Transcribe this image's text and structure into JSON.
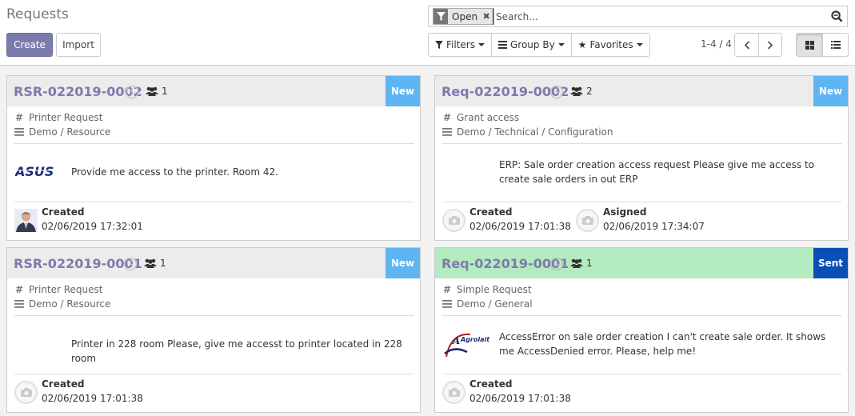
{
  "header": {
    "title": "Requests",
    "create_label": "Create",
    "import_label": "Import"
  },
  "search": {
    "facet_label": "Open",
    "placeholder": "Search..."
  },
  "filters": {
    "filters_label": "Filters",
    "groupby_label": "Group By",
    "favorites_label": "Favorites"
  },
  "pager": {
    "value": "1-4 / 4"
  },
  "colors": {
    "accent": "#7c7bad",
    "stage_new": "#5db5f1",
    "stage_sent": "#0a4fb5",
    "sent_header": "#b5ebc0"
  },
  "cards": [
    {
      "ref": "RSR-022019-0002",
      "followers": "1",
      "stage": "New",
      "type": "Printer Request",
      "category": "Demo / Resource",
      "logo": "asus-logo",
      "description": "Provide me access to the printer. Room 42.",
      "activities": [
        {
          "name": "Created",
          "date": "02/06/2019 17:32:01",
          "avatar": "user-photo"
        }
      ]
    },
    {
      "ref": "Req-022019-0002",
      "followers": "2",
      "stage": "New",
      "type": "Grant access",
      "category": "Demo / Technical / Configuration",
      "logo": "",
      "description": "ERP: Sale order creation access request Please give me access to create sale orders in out ERP",
      "activities": [
        {
          "name": "Created",
          "date": "02/06/2019 17:01:38",
          "avatar": "camera-placeholder"
        },
        {
          "name": "Asigned",
          "date": "02/06/2019 17:34:07",
          "avatar": "camera-placeholder"
        }
      ]
    },
    {
      "ref": "RSR-022019-0001",
      "followers": "1",
      "stage": "New",
      "type": "Printer Request",
      "category": "Demo / Resource",
      "logo": "",
      "description": "Printer in 228 room Please, give me accesst to printer located in 228 room",
      "activities": [
        {
          "name": "Created",
          "date": "02/06/2019 17:01:38",
          "avatar": "camera-placeholder"
        }
      ]
    },
    {
      "ref": "Req-022019-0001",
      "followers": "1",
      "stage": "Sent",
      "type": "Simple Request",
      "category": "Demo / General",
      "logo": "agrolait-logo",
      "logo_text": "Agrolait",
      "description": "AccessError on sale order creation I can't create sale order. It shows me AccessDenied error. Please, help me!",
      "activities": [
        {
          "name": "Created",
          "date": "02/06/2019 17:01:38",
          "avatar": "camera-placeholder"
        }
      ]
    }
  ]
}
